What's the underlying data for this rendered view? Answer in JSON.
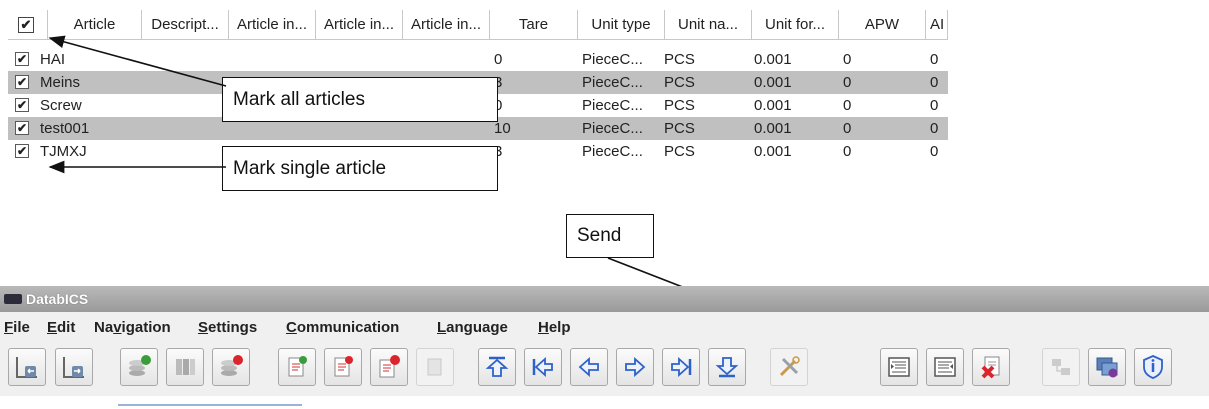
{
  "table": {
    "columns": [
      "Article",
      "Descript...",
      "Article in...",
      "Article in...",
      "Article in...",
      "Tare",
      "Unit type",
      "Unit na...",
      "Unit for...",
      "APW",
      "AI"
    ],
    "header_checkbox": "✔",
    "rows": [
      {
        "checked": "✔",
        "article": "HAI",
        "tare": "0",
        "unit_type": "PieceC...",
        "unit_name": "PCS",
        "unit_factor": "0.001",
        "apw": "0",
        "ai": "0"
      },
      {
        "checked": "✔",
        "article": "Meins",
        "tare": "3",
        "unit_type": "PieceC...",
        "unit_name": "PCS",
        "unit_factor": "0.001",
        "apw": "0",
        "ai": "0"
      },
      {
        "checked": "✔",
        "article": "Screw",
        "tare": "0",
        "unit_type": "PieceC...",
        "unit_name": "PCS",
        "unit_factor": "0.001",
        "apw": "0",
        "ai": "0"
      },
      {
        "checked": "✔",
        "article": "test001",
        "tare": "10",
        "unit_type": "PieceC...",
        "unit_name": "PCS",
        "unit_factor": "0.001",
        "apw": "0",
        "ai": "0"
      },
      {
        "checked": "✔",
        "article": "TJMXJ",
        "tare": "3",
        "unit_type": "PieceC...",
        "unit_name": "PCS",
        "unit_factor": "0.001",
        "apw": "0",
        "ai": "0"
      }
    ]
  },
  "callouts": {
    "mark_all": "Mark all articles",
    "mark_single": "Mark single article",
    "send": "Send"
  },
  "window": {
    "title": "DatabICS",
    "menu": [
      "File",
      "Edit",
      "Navigation",
      "Settings",
      "Communication",
      "Language",
      "Help"
    ]
  },
  "toolbar_icons": [
    "import-icon",
    "export-icon",
    "db-add-icon",
    "db-list-icon",
    "db-delete-icon",
    "doc-new-icon",
    "doc-edit-icon",
    "doc-delete-icon",
    "doc-disabled-icon",
    "nav-first-icon",
    "nav-prev-page-icon",
    "nav-prev-icon",
    "nav-next-icon",
    "nav-next-page-icon",
    "nav-last-icon",
    "tools-icon",
    "send-icon",
    "receive-icon",
    "clear-icon",
    "network-icon",
    "devices-icon",
    "info-shield-icon"
  ],
  "colors": {
    "row_alt": "#c0c0c0",
    "titlebar": "#a8a8a8",
    "accent_blue": "#2f62c9",
    "delete_red": "#d9252b"
  }
}
